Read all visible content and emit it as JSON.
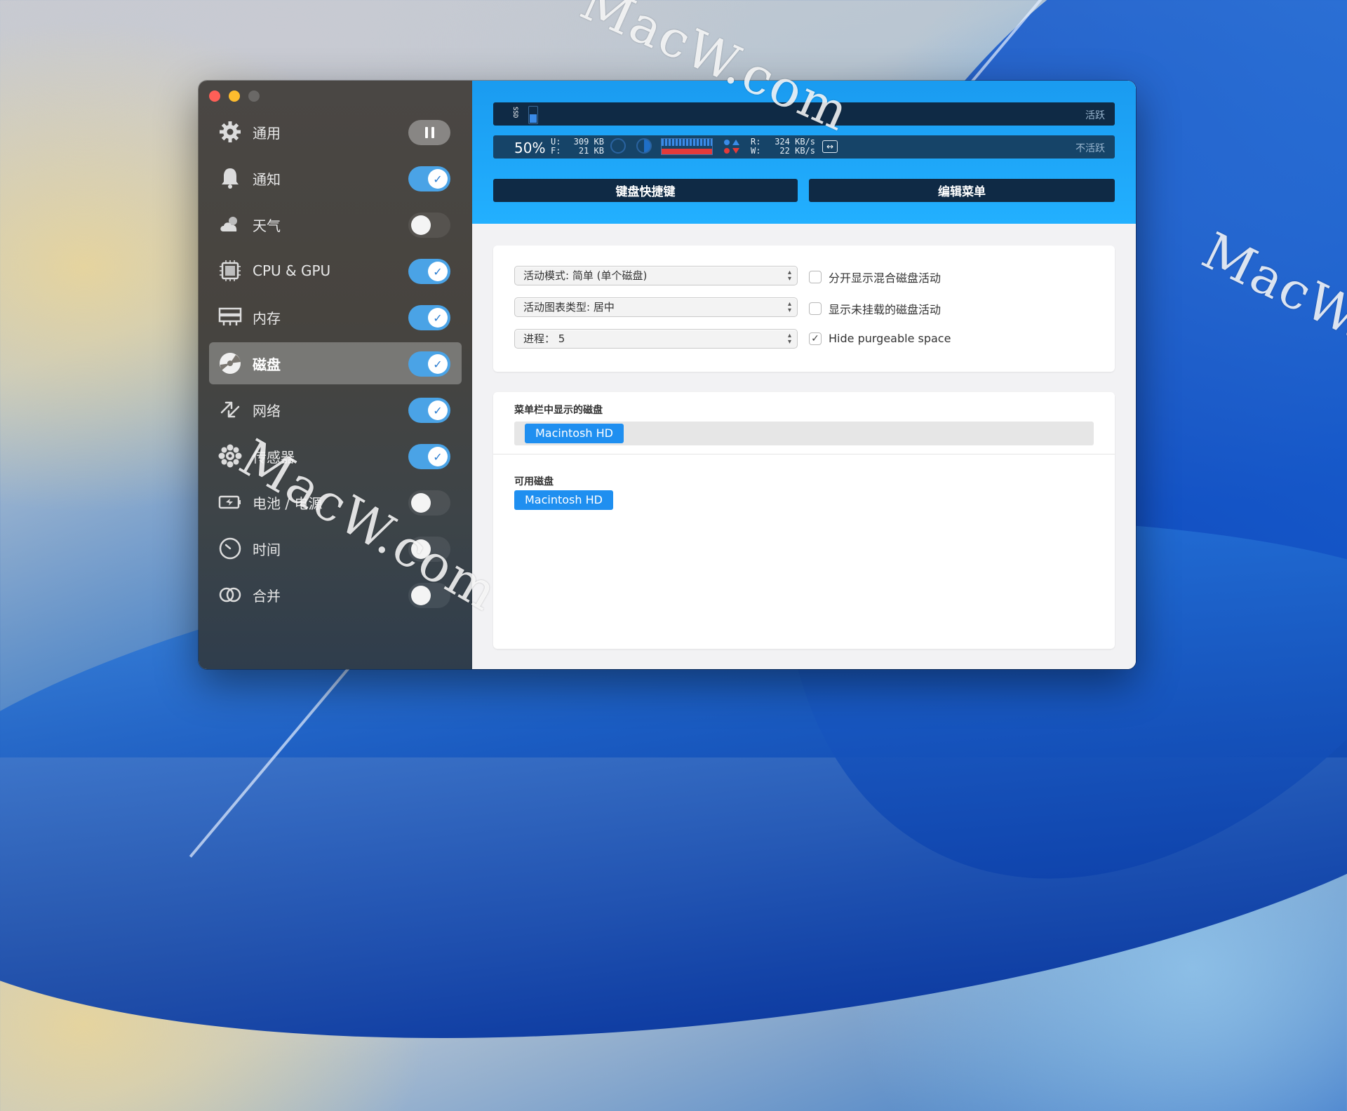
{
  "sidebar": {
    "items": [
      {
        "label": "通用",
        "icon": "gear-icon",
        "toggle": "pause"
      },
      {
        "label": "通知",
        "icon": "bell-icon",
        "toggle": "on"
      },
      {
        "label": "天气",
        "icon": "weather-icon",
        "toggle": "off"
      },
      {
        "label": "CPU & GPU",
        "icon": "cpu-icon",
        "toggle": "on"
      },
      {
        "label": "内存",
        "icon": "memory-icon",
        "toggle": "on"
      },
      {
        "label": "磁盘",
        "icon": "disk-icon",
        "toggle": "on",
        "selected": true
      },
      {
        "label": "网络",
        "icon": "network-icon",
        "toggle": "on"
      },
      {
        "label": "传感器",
        "icon": "sensor-icon",
        "toggle": "on"
      },
      {
        "label": "电池 / 电源",
        "icon": "battery-icon",
        "toggle": "off"
      },
      {
        "label": "时间",
        "icon": "clock-icon",
        "toggle": "off"
      },
      {
        "label": "合并",
        "icon": "combine-icon",
        "toggle": "off"
      }
    ]
  },
  "preview": {
    "ssd_label": "SSD",
    "active_label": "活跃",
    "inactive_label": "不活跃",
    "percent": "50%",
    "used_key": "U:",
    "used_val": "309 KB",
    "free_key": "F:",
    "free_val": "21 KB",
    "read_key": "R:",
    "read_val": "324 KB/s",
    "write_key": "W:",
    "write_val": "22 KB/s"
  },
  "buttons": {
    "shortcuts": "键盘快捷键",
    "edit_menu": "编辑菜单"
  },
  "settings": {
    "mode_select": "活动模式: 简单 (单个磁盘)",
    "chart_type_select": "活动图表类型: 居中",
    "process_select": "进程： 5",
    "split_checkbox": "分开显示混合磁盘活动",
    "unmounted_checkbox": "显示未挂载的磁盘活动",
    "purgeable_checkbox": "Hide purgeable space"
  },
  "disks": {
    "menubar_title": "菜单栏中显示的磁盘",
    "menubar_disk": "Macintosh HD",
    "available_title": "可用磁盘",
    "available_disk": "Macintosh HD"
  },
  "watermark": "MacW.com",
  "colors": {
    "accent": "#1f8ff0",
    "header": "#1a9bf0",
    "toggle_on": "#4aa3e6"
  }
}
